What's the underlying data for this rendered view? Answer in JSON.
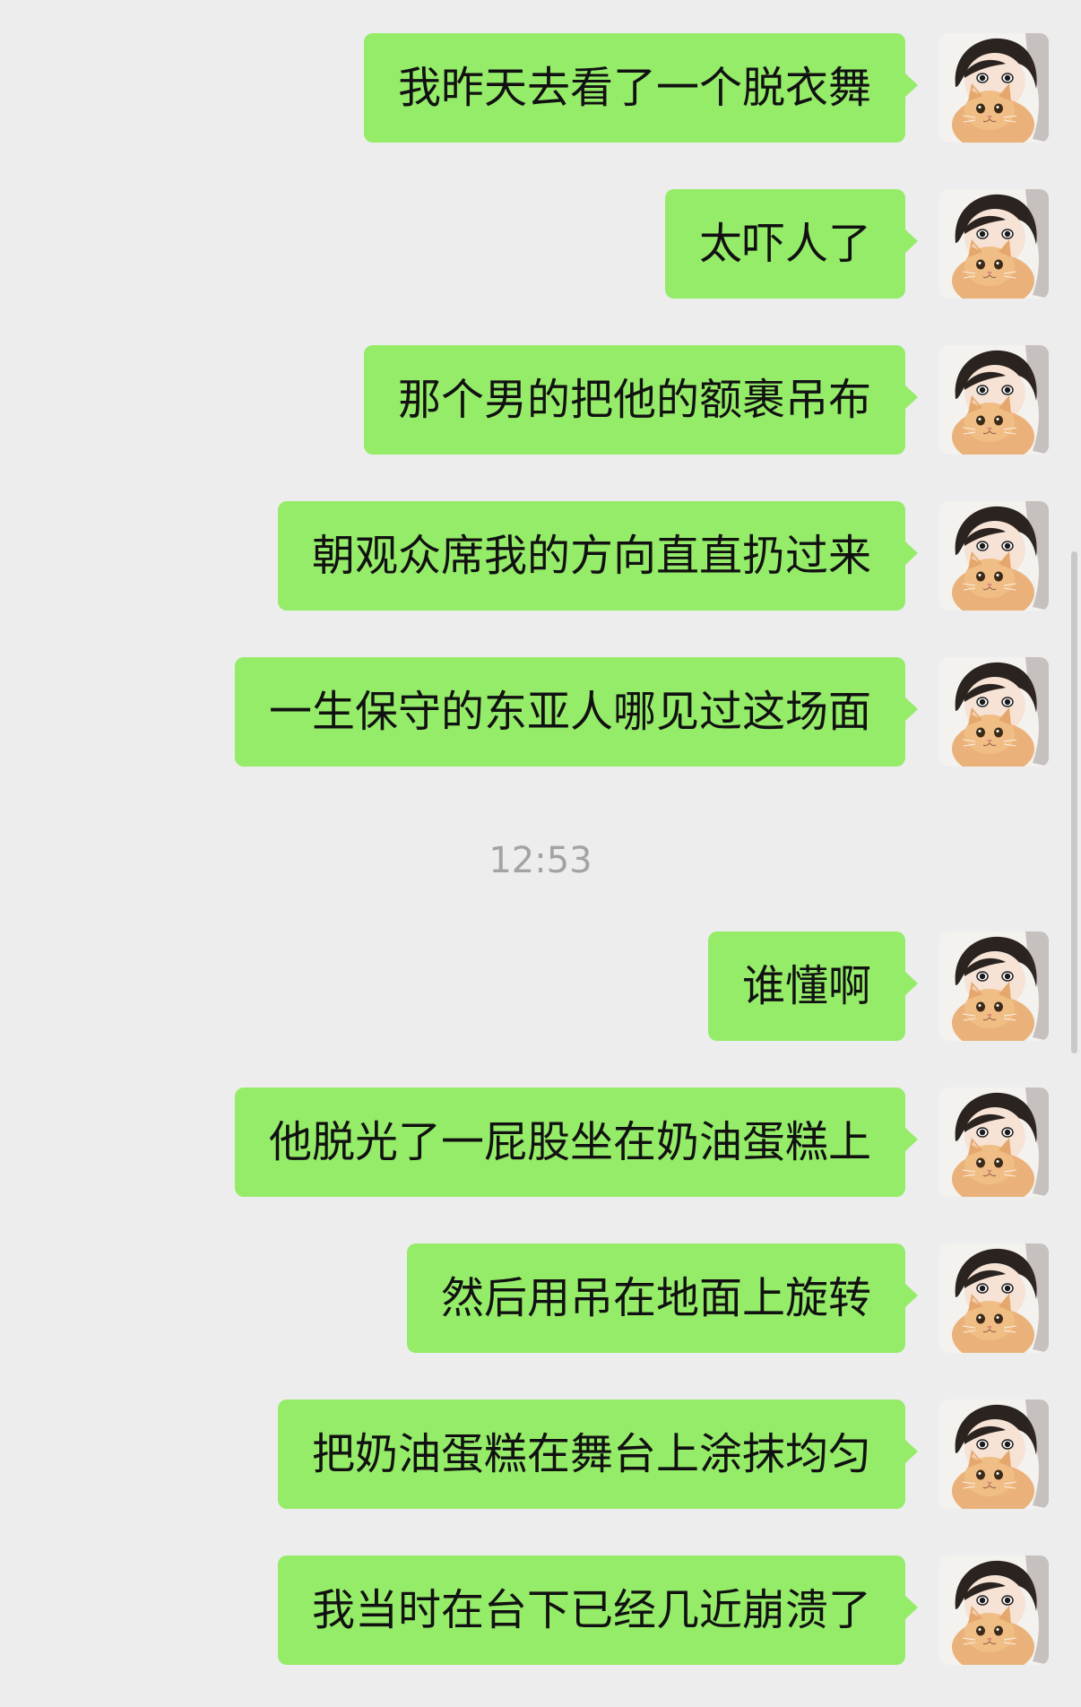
{
  "chat": {
    "messages_before": [
      {
        "text": "我昨天去看了一个脱衣舞"
      },
      {
        "text": "太吓人了"
      },
      {
        "text": "那个男的把他的额裹吊布"
      },
      {
        "text": "朝观众席我的方向直直扔过来"
      },
      {
        "text": "一生保守的东亚人哪见过这场面"
      }
    ],
    "timestamp": "12:53",
    "messages_after": [
      {
        "text": "谁懂啊"
      },
      {
        "text": "他脱光了一屁股坐在奶油蛋糕上"
      },
      {
        "text": "然后用吊在地面上旋转"
      },
      {
        "text": "把奶油蛋糕在舞台上涂抹均匀"
      },
      {
        "text": "我当时在台下已经几近崩溃了"
      }
    ]
  },
  "colors": {
    "background": "#ededed",
    "bubble_self": "#95ec69",
    "timestamp_text": "#a3a3a3"
  },
  "icons": {
    "avatar": "user-avatar-girl-with-cat"
  }
}
